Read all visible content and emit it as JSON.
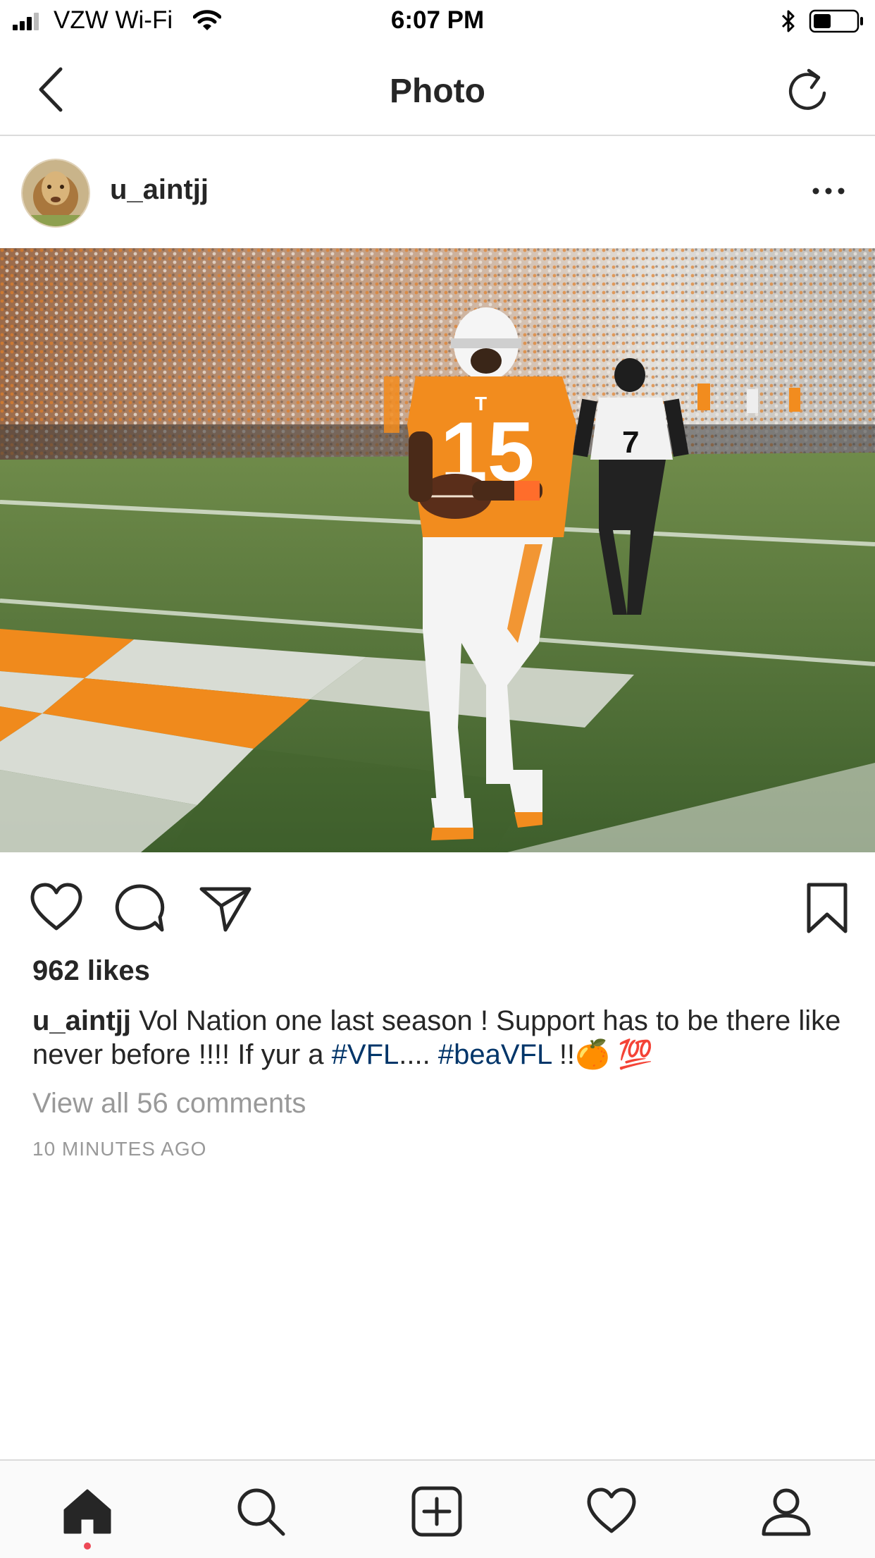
{
  "status_bar": {
    "carrier": "VZW Wi-Fi",
    "time": "6:07 PM",
    "icons": [
      "signal-icon",
      "wifi-icon",
      "bluetooth-icon",
      "battery-icon"
    ]
  },
  "nav": {
    "title": "Photo",
    "back_icon": "chevron-left-icon",
    "refresh_icon": "refresh-icon"
  },
  "post": {
    "username": "u_aintjj",
    "more_icon": "more-horizontal-icon",
    "likes": "962 likes",
    "caption_username": "u_aintjj",
    "caption_text_1": " Vol Nation one last season ! Support has to be there like never before !!!! If yur a ",
    "hashtag_1": "#VFL",
    "caption_text_2": ".... ",
    "hashtag_2": "#beaVFL",
    "caption_text_3": " !!🍊 💯",
    "view_comments": "View all 56 comments",
    "time_ago": "10 MINUTES AGO"
  },
  "actions": [
    "heart-icon",
    "comment-icon",
    "share-icon",
    "bookmark-icon"
  ],
  "tabs": [
    "home-icon",
    "search-icon",
    "add-post-icon",
    "activity-icon",
    "profile-icon"
  ],
  "colors": {
    "hashtag": "#003569",
    "secondary_text": "#999999",
    "notification_dot": "#ed4956",
    "tennessee_orange": "#f28c1e"
  }
}
